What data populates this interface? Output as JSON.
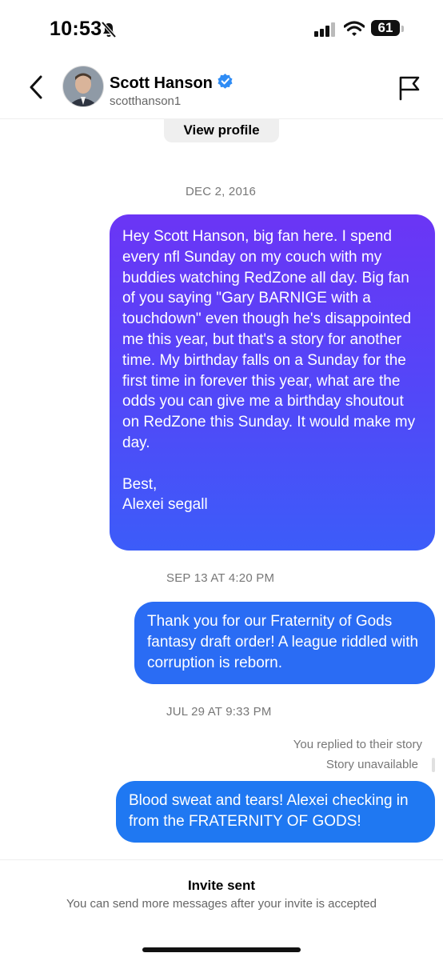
{
  "status": {
    "time": "10:53",
    "battery": "61"
  },
  "header": {
    "name": "Scott Hanson",
    "username": "scotthanson1"
  },
  "view_profile": "View profile",
  "messages": [
    {
      "date": "DEC 2, 2016",
      "text": "Hey Scott Hanson, big fan here. I spend every nfl Sunday on my couch with my buddies watching RedZone all day. Big fan of you saying \"Gary BARNIGE with a touchdown\" even though he's disappointed me this year, but that's a story for another time. My birthday falls on a Sunday for the first time in forever this year, what are the odds you can give me a birthday shoutout on RedZone this Sunday. It would make my day.\n\nBest,\nAlexei segall"
    },
    {
      "date": "SEP 13 AT 4:20 PM",
      "text": "Thank you for our Fraternity of Gods fantasy draft order! A league riddled with corruption is reborn."
    },
    {
      "date": "JUL 29 AT 9:33 PM",
      "note": "You replied to their story",
      "story_status": "Story unavailable",
      "text": "Blood sweat and tears! Alexei checking in from the FRATERNITY OF GODS!"
    }
  ],
  "footer": {
    "title": "Invite sent",
    "subtitle": "You can send more messages after your invite is accepted"
  },
  "colors": {
    "bubble_gradient_top": "#6b35f5",
    "bubble_gradient_bottom": "#3c5cf9",
    "bubble_blue": "#2a6cf4",
    "verified": "#2f8cf5"
  }
}
